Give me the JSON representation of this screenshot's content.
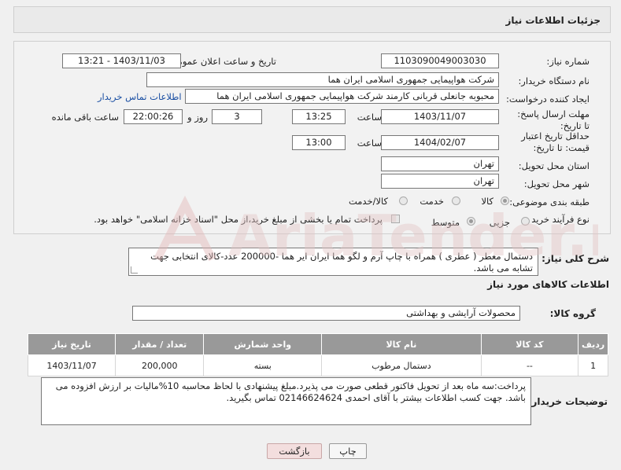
{
  "header": {
    "title": "جزئیات اطلاعات نیاز"
  },
  "form": {
    "need_number_label": "شماره نیاز:",
    "need_number": "1103090049003030",
    "announce_label": "تاریخ و ساعت اعلان عمومی:",
    "announce_value": "1403/11/03 - 13:21",
    "buyer_org_label": "نام دستگاه خریدار:",
    "buyer_org": "شرکت هواپیمایی جمهوری اسلامی ایران هما",
    "requester_label": "ایجاد کننده درخواست:",
    "requester": "محبوبه جانعلی قربانی کارمند شرکت هواپیمایی جمهوری اسلامی ایران هما",
    "buyer_contact_link": "اطلاعات تماس خریدار",
    "deadline_label": "مهلت ارسال پاسخ: تا تاریخ:",
    "deadline_date": "1403/11/07",
    "hour_label": "ساعت",
    "deadline_time": "13:25",
    "days_value": "3",
    "days_label": "روز و",
    "remaining_time": "22:00:26",
    "remaining_label": "ساعت باقی مانده",
    "validity_label": "حداقل تاریخ اعتبار قیمت: تا تاریخ:",
    "validity_date": "1404/02/07",
    "validity_hour_label": "ساعت",
    "validity_time": "13:00",
    "province_label": "استان محل تحویل:",
    "province": "تهران",
    "city_label": "شهر محل تحویل:",
    "city": "تهران",
    "category_label": "طبقه بندی موضوعی:",
    "category_options": [
      "کالا",
      "خدمت",
      "کالا/خدمت"
    ],
    "process_label": "نوع فرآیند خرید :",
    "process_options": [
      "جزیی",
      "متوسط"
    ],
    "payment_note": "پرداخت تمام یا بخشی از مبلغ خرید،از محل \"اسناد خزانه اسلامی\" خواهد بود."
  },
  "description": {
    "label": "شرح کلی نیاز:",
    "text": "دستمال معطر ( عطری ) همراه با چاپ آرم و لگو هما ایران ایر هما -200000 عدد-کالای انتخابی جهت تشابه می باشد."
  },
  "goods": {
    "section_title": "اطلاعات کالاهای مورد نیاز",
    "group_label": "گروه کالا:",
    "group_value": "محصولات آرایشی و بهداشتی",
    "columns": [
      "ردیف",
      "کد کالا",
      "نام کالا",
      "واحد شمارش",
      "تعداد / مقدار",
      "تاریخ نیاز"
    ],
    "rows": [
      [
        "1",
        "--",
        "دستمال مرطوب",
        "بسته",
        "200,000",
        "1403/11/07"
      ]
    ]
  },
  "buyer_notes": {
    "label": "توضیحات خریدار:",
    "text": "پرداخت:سه ماه بعد از تحویل فاکتور قطعی صورت می پذیرد.مبلغ پیشنهادی با لحاظ محاسبه 10%مالیات بر ارزش افزوده می باشد. جهت کسب اطلاعات بیشتر با آقای احمدی 02146624624 تماس بگیرید."
  },
  "buttons": {
    "print": "چاپ",
    "back": "بازگشت"
  },
  "watermark": {
    "text": "AriaTender.neT"
  }
}
